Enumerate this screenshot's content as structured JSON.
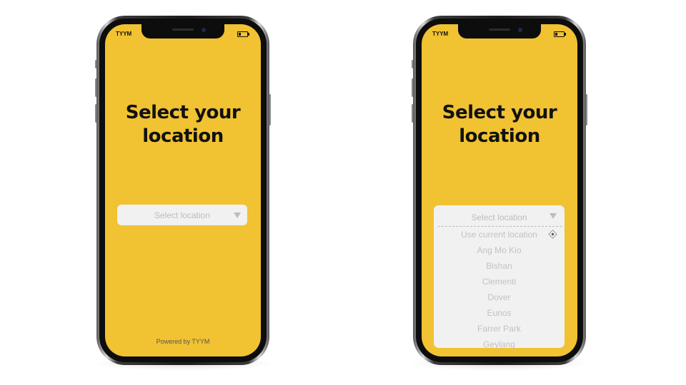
{
  "left_phone": {
    "status": {
      "carrier": "TYYM",
      "battery_level": 0.3
    },
    "title": {
      "line1": "Select your",
      "line2": "location"
    },
    "select": {
      "placeholder": "Select location"
    },
    "footer": {
      "powered_by": "Powered by TYYM"
    }
  },
  "right_phone": {
    "status": {
      "carrier": "TYYM",
      "battery_level": 0.3
    },
    "title": {
      "line1": "Select your",
      "line2": "location"
    },
    "dropdown": {
      "placeholder": "Select location",
      "current_location": "Use current location",
      "options": [
        "Ang Mo Kio",
        "Bishan",
        "Clementi",
        "Dover",
        "Eunos",
        "Farrer Park",
        "Geylang"
      ]
    }
  },
  "colors": {
    "background": "#f1c232",
    "select_bg": "#f1f1f1",
    "placeholder_text": "#bcbcbc"
  },
  "icons": {
    "caret": "chevron-down-icon",
    "location": "location-icon",
    "battery": "battery-icon"
  }
}
